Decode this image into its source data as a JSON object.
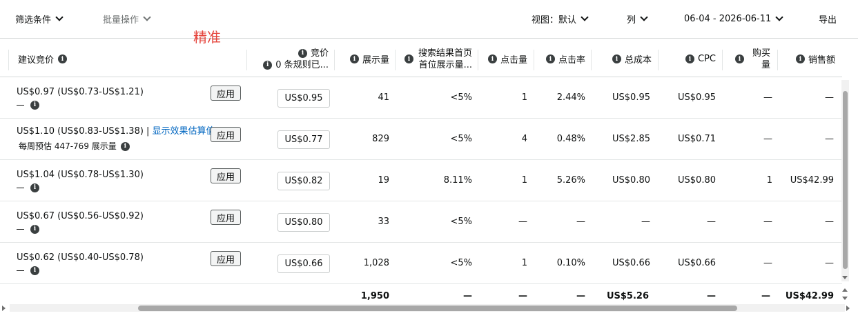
{
  "toolbar": {
    "filter_label": "筛选条件",
    "bulk_label": "批量操作",
    "view_label": "视图：默认",
    "columns_label": "列",
    "date_range": "06-04 - 2026-06-11",
    "export_label": "导出"
  },
  "annotation": "精准",
  "header": {
    "suggested_bid": "建议竞价",
    "bid": "竞价",
    "bid_rules": "0 条规则已...",
    "impressions": "展示量",
    "top_search_line1": "搜索结果首页",
    "top_search_line2": "首位展示量...",
    "clicks": "点击量",
    "ctr": "点击率",
    "total_cost": "总成本",
    "cpc": "CPC",
    "purchases_line1": "购买",
    "purchases_line2": "量",
    "sales": "销售额"
  },
  "apply_label": "应用",
  "rows": [
    {
      "suggested": "US$0.97 (US$0.73-US$1.21)",
      "sub_dash": true,
      "sub_text": "",
      "link": "",
      "bid": "US$0.95",
      "impressions": "41",
      "top_search": "<5%",
      "clicks": "1",
      "ctr": "2.44%",
      "cost": "US$0.95",
      "cpc": "US$0.95",
      "purchases": "—",
      "sales": "—"
    },
    {
      "suggested": "US$1.10 (US$0.83-US$1.38) |",
      "sub_dash": false,
      "sub_text": "每周预估 447-769 展示量",
      "link": "显示效果估算值",
      "bid": "US$0.77",
      "impressions": "829",
      "top_search": "<5%",
      "clicks": "4",
      "ctr": "0.48%",
      "cost": "US$2.85",
      "cpc": "US$0.71",
      "purchases": "—",
      "sales": "—"
    },
    {
      "suggested": "US$1.04 (US$0.78-US$1.30)",
      "sub_dash": true,
      "sub_text": "",
      "link": "",
      "bid": "US$0.82",
      "impressions": "19",
      "top_search": "8.11%",
      "clicks": "1",
      "ctr": "5.26%",
      "cost": "US$0.80",
      "cpc": "US$0.80",
      "purchases": "1",
      "sales": "US$42.99"
    },
    {
      "suggested": "US$0.67 (US$0.56-US$0.92)",
      "sub_dash": true,
      "sub_text": "",
      "link": "",
      "bid": "US$0.80",
      "impressions": "33",
      "top_search": "<5%",
      "clicks": "—",
      "ctr": "—",
      "cost": "—",
      "cpc": "—",
      "purchases": "—",
      "sales": "—"
    },
    {
      "suggested": "US$0.62 (US$0.40-US$0.78)",
      "sub_dash": true,
      "sub_text": "",
      "link": "",
      "bid": "US$0.66",
      "impressions": "1,028",
      "top_search": "<5%",
      "clicks": "1",
      "ctr": "0.10%",
      "cost": "US$0.66",
      "cpc": "US$0.66",
      "purchases": "—",
      "sales": "—"
    }
  ],
  "totals": {
    "impressions": "1,950",
    "top_search": "—",
    "clicks": "—",
    "ctr": "—",
    "cost": "US$5.26",
    "cpc": "—",
    "purchases": "—",
    "sales": "US$42.99"
  },
  "colors": {
    "link": "#0066c0",
    "annotation": "#e5443c"
  }
}
